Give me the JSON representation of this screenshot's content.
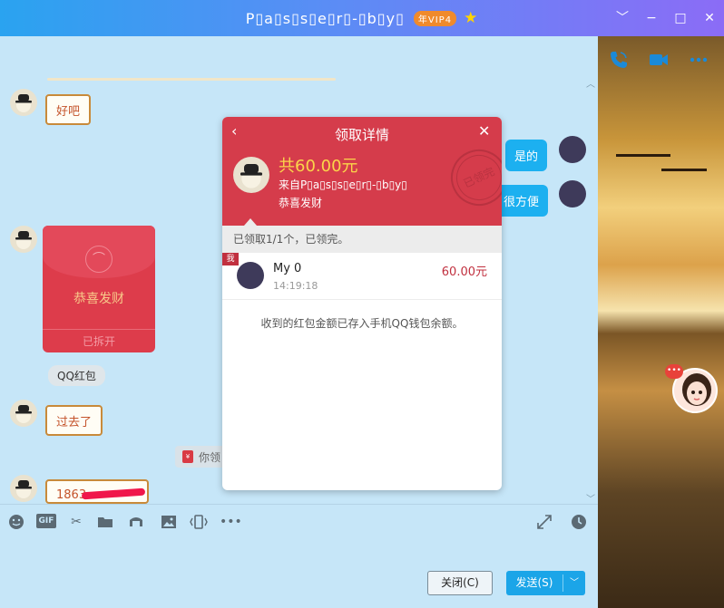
{
  "window": {
    "title": "P\u0000a\u0000s\u0000s\u0000e\u0000r\u0000-\u0000b\u0000y\u0000",
    "title_display": "P▯a▯s▯s▯e▯r▯-▯b▯y▯",
    "vip_badge": "年VIP4",
    "minimize": "−",
    "restore": "□",
    "close": "✕",
    "collapse": "﹀"
  },
  "messages": {
    "left_1": "好吧",
    "right_1": "是的",
    "right_2": "很方便",
    "left_2": "过去了",
    "left_3": "1863"
  },
  "redpacket": {
    "title": "恭喜发财",
    "status": "已拆开",
    "source": "QQ红包"
  },
  "system_notice": {
    "text": "你领"
  },
  "popup": {
    "title": "领取详情",
    "amount": "共60.00元",
    "from": "来自P▯a▯s▯s▯e▯r▯-▯b▯y▯",
    "greeting": "恭喜发财",
    "stamp": "已领完",
    "summary": "已领取1/1个，已领完。",
    "row": {
      "tag": "我",
      "name": "My 0",
      "time": "14:19:18",
      "amount": "60.00元"
    },
    "note": "收到的红包金额已存入手机QQ钱包余额。"
  },
  "buttons": {
    "close": "关闭(C)",
    "send": "发送(S)"
  },
  "icons": {
    "phone": "phone-icon",
    "video": "video-icon",
    "more": "more-icon",
    "emoji": "emoji-icon",
    "gif": "GIF",
    "scissors": "scissors-icon",
    "folder": "folder-icon",
    "music": "music-icon",
    "image": "image-icon",
    "shake": "shake-icon",
    "history": "history-icon",
    "expand": "expand-icon"
  },
  "colors": {
    "titlebar_start": "#2aa3f0",
    "titlebar_end": "#8b6cf6",
    "chat_bg": "#c6e6f8",
    "popup_red": "#d53c4b",
    "send_blue": "#1ba5e8",
    "amount_yellow": "#fbd54a"
  }
}
